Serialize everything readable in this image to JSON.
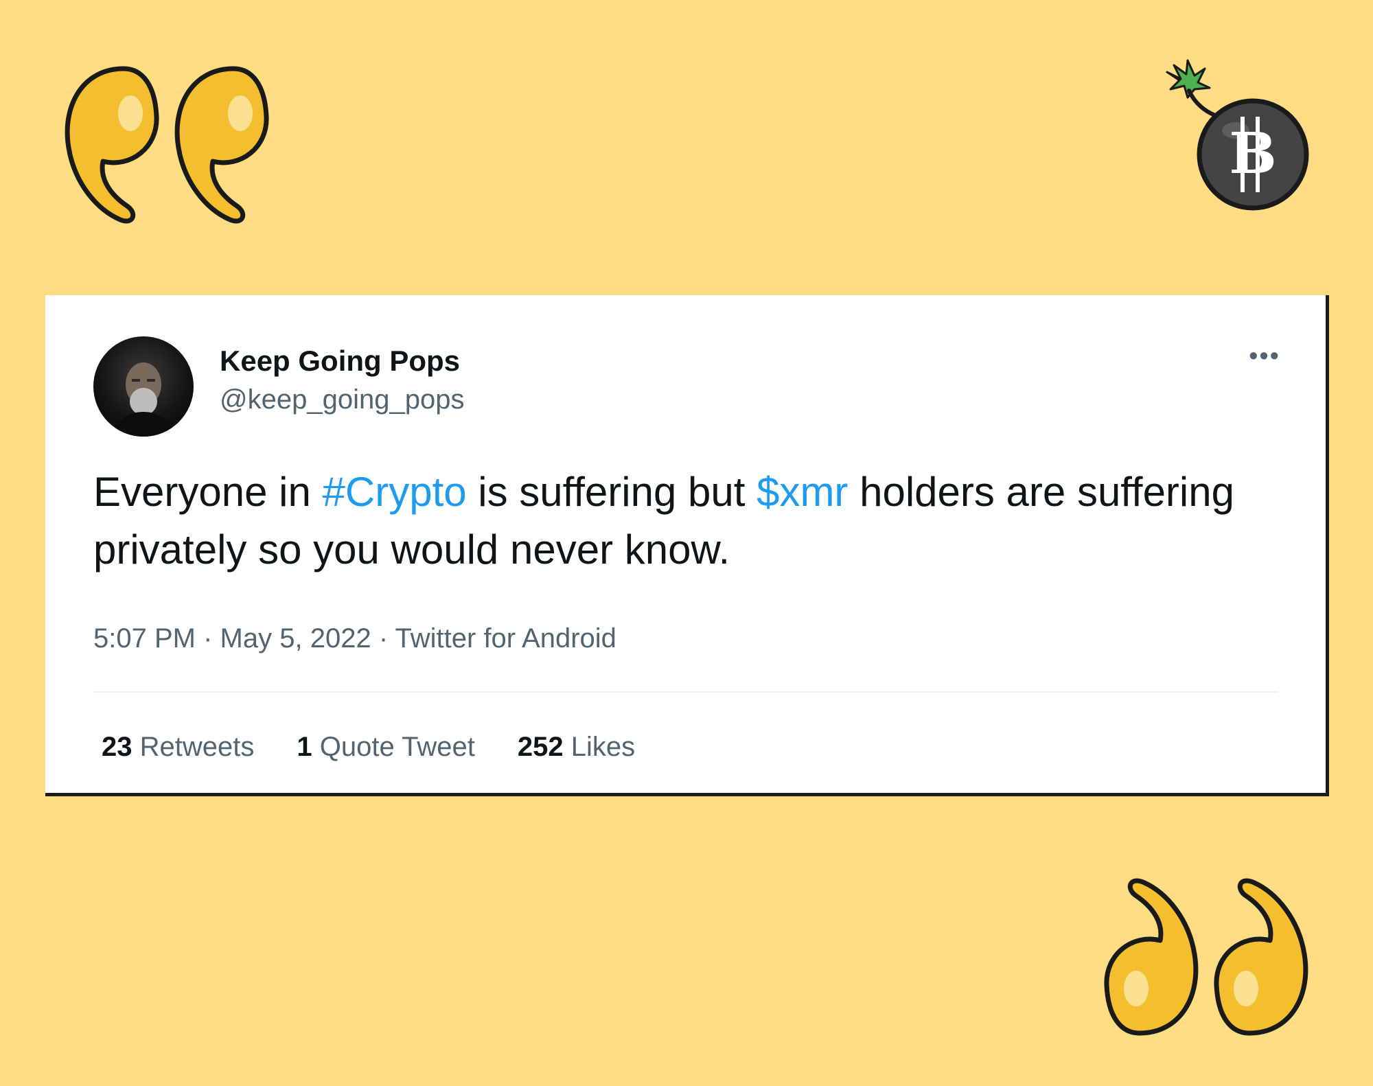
{
  "tweet": {
    "display_name": "Keep Going Pops",
    "handle": "@keep_going_pops",
    "more_icon": "ellipsis-icon",
    "text": {
      "part1": "Everyone in ",
      "hashtag": "#Crypto",
      "part2": " is suffering but ",
      "cashtag": "$xmr",
      "part3": " holders are suffering privately so you would never know."
    },
    "time": "5:07 PM",
    "date": "May 5, 2022",
    "source": "Twitter for Android",
    "separator": "·",
    "stats": {
      "retweets_count": "23",
      "retweets_label": "Retweets",
      "quotes_count": "1",
      "quotes_label": "Quote Tweet",
      "likes_count": "252",
      "likes_label": "Likes"
    }
  },
  "decor": {
    "open_quote_icon": "open-quote-icon",
    "close_quote_icon": "close-quote-icon",
    "bomb_icon": "bitcoin-bomb-icon",
    "bomb_symbol": "B",
    "background_color": "#FDDC83",
    "quote_color": "#F5BE2E",
    "link_color": "#1d9bf0"
  }
}
